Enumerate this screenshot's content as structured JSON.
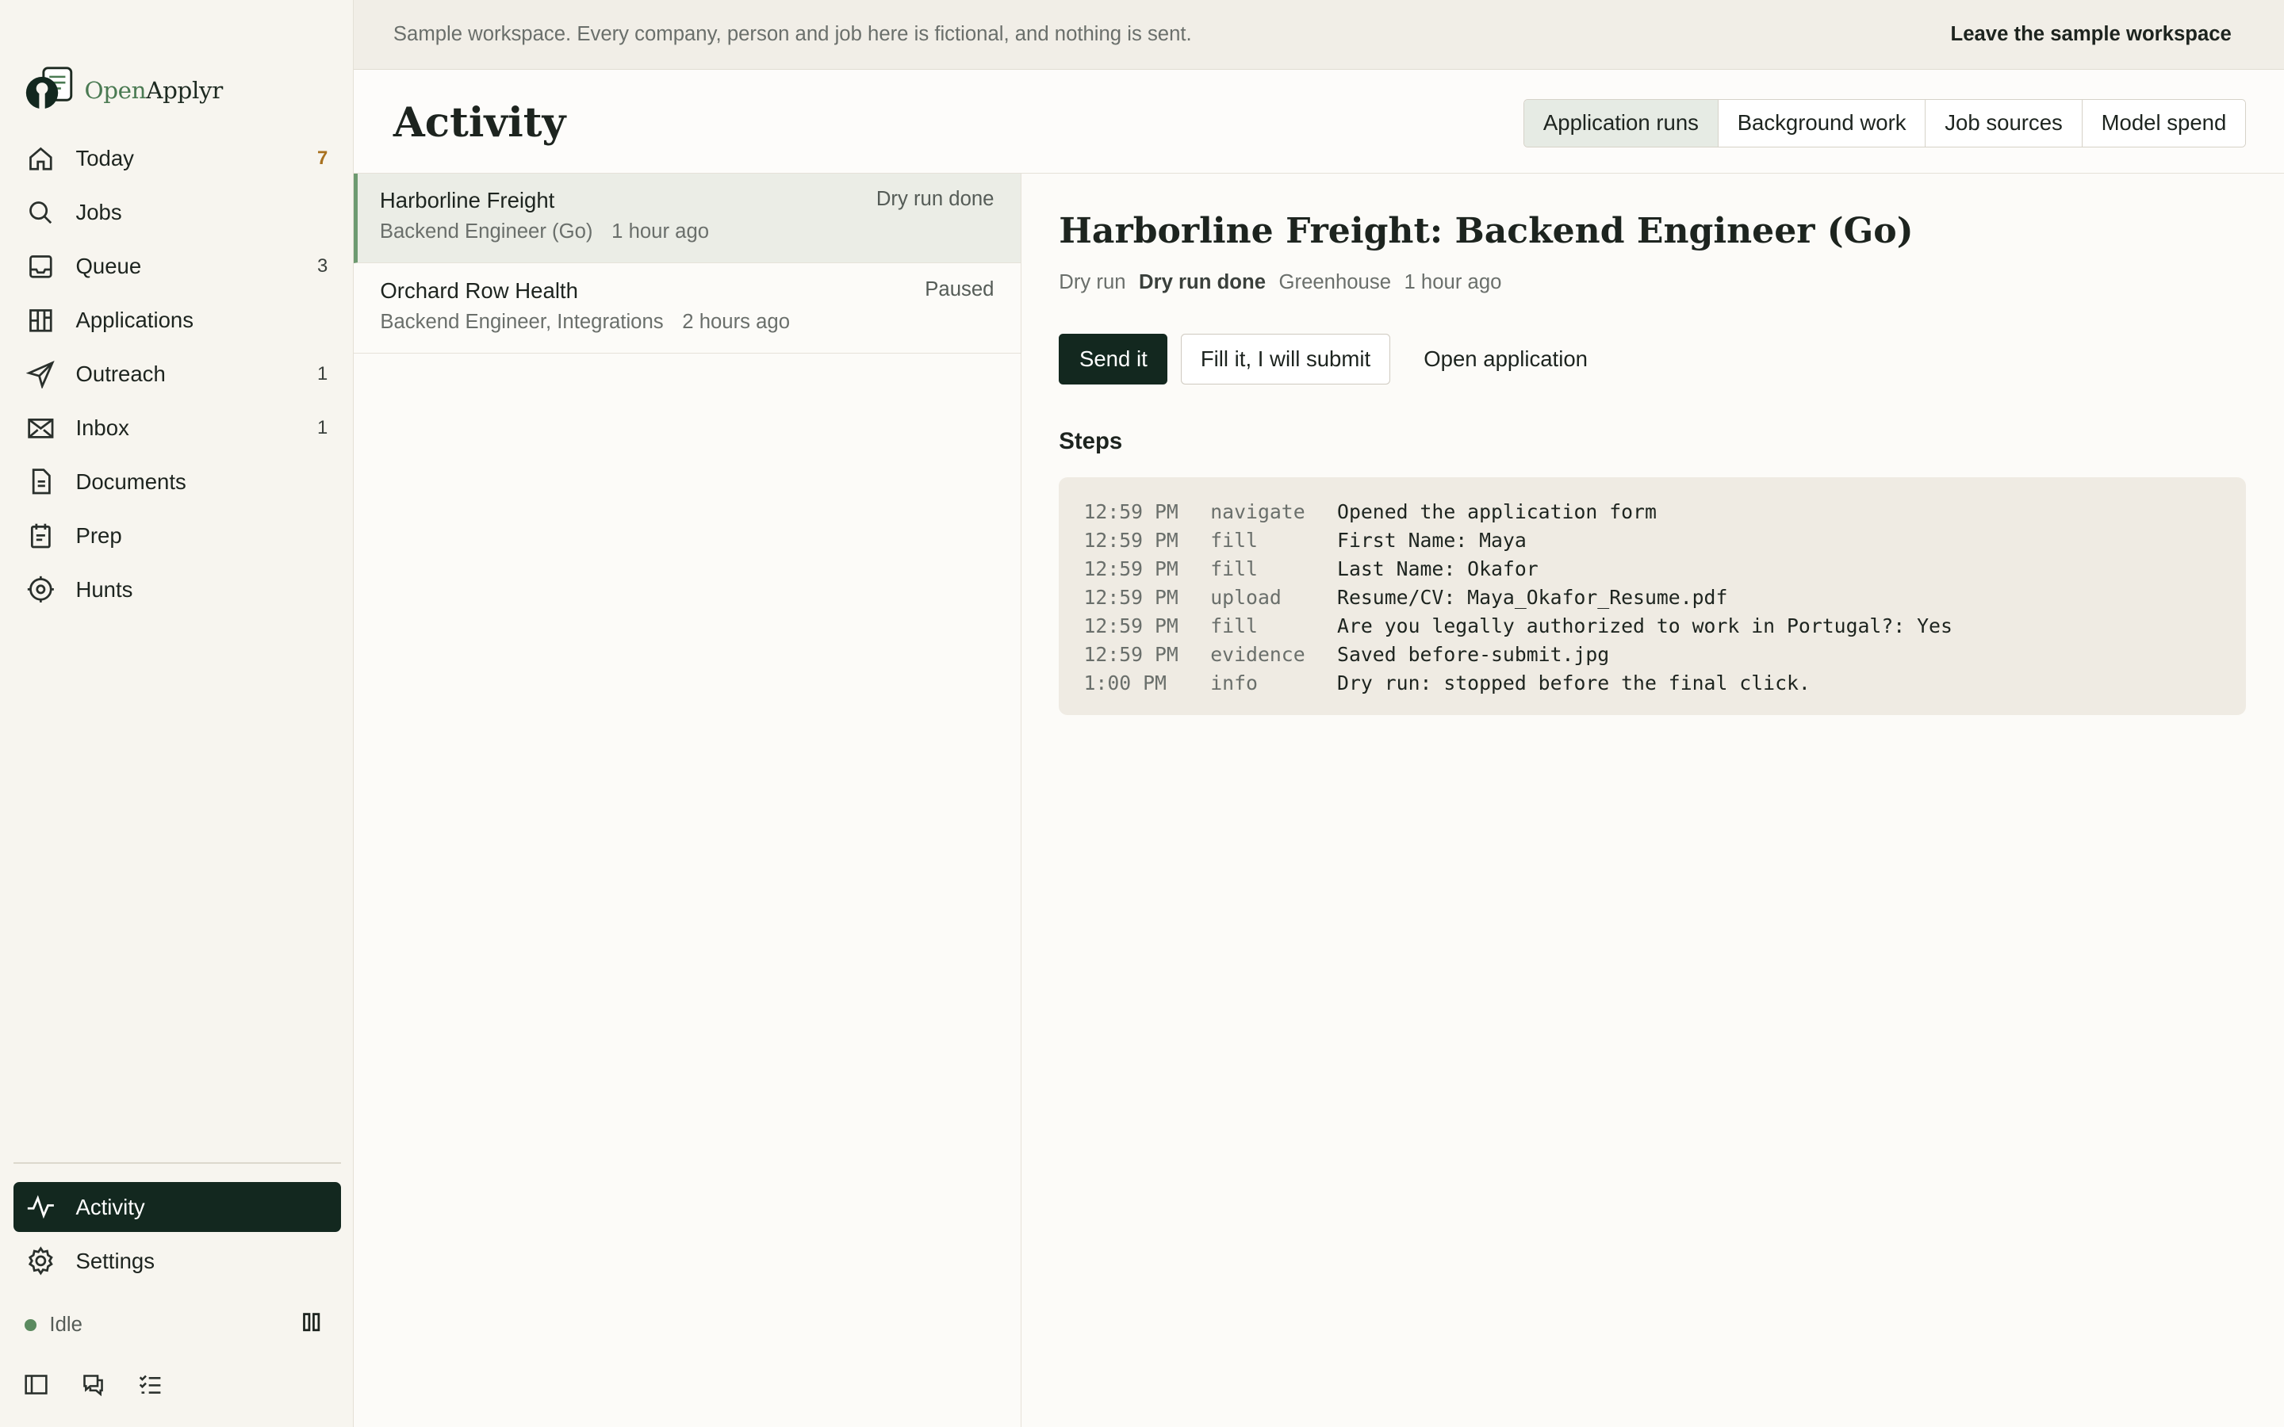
{
  "app": {
    "name_part1": "Open",
    "name_part2": "Applyr"
  },
  "banner": {
    "message": "Sample workspace. Every company, person and job here is fictional, and nothing is sent.",
    "leave_label": "Leave the sample workspace"
  },
  "nav": {
    "items": [
      {
        "label": "Today",
        "count": "7",
        "icon": "home-icon"
      },
      {
        "label": "Jobs",
        "count": "",
        "icon": "search-icon"
      },
      {
        "label": "Queue",
        "count": "3",
        "icon": "inbox-tray-icon"
      },
      {
        "label": "Applications",
        "count": "",
        "icon": "kanban-icon"
      },
      {
        "label": "Outreach",
        "count": "1",
        "icon": "send-icon"
      },
      {
        "label": "Inbox",
        "count": "1",
        "icon": "mail-icon"
      },
      {
        "label": "Documents",
        "count": "",
        "icon": "document-icon"
      },
      {
        "label": "Prep",
        "count": "",
        "icon": "calendar-icon"
      },
      {
        "label": "Hunts",
        "count": "",
        "icon": "target-icon"
      }
    ],
    "bottom": [
      {
        "label": "Activity",
        "icon": "activity-icon"
      },
      {
        "label": "Settings",
        "icon": "gear-icon"
      }
    ]
  },
  "status": {
    "label": "Idle"
  },
  "page": {
    "title": "Activity",
    "tabs": [
      "Application runs",
      "Background work",
      "Job sources",
      "Model spend"
    ],
    "active_tab": "Application runs"
  },
  "runs": [
    {
      "company": "Harborline Freight",
      "status": "Dry run done",
      "role": "Backend Engineer (Go)",
      "time": "1 hour ago"
    },
    {
      "company": "Orchard Row Health",
      "status": "Paused",
      "role": "Backend Engineer, Integrations",
      "time": "2 hours ago"
    }
  ],
  "detail": {
    "title": "Harborline Freight: Backend Engineer (Go)",
    "meta": {
      "mode": "Dry run",
      "status": "Dry run done",
      "source": "Greenhouse",
      "time": "1 hour ago"
    },
    "actions": {
      "send": "Send it",
      "fill": "Fill it, I will submit",
      "open": "Open application"
    },
    "steps_heading": "Steps",
    "steps": [
      {
        "time": "12:59 PM",
        "kind": "navigate",
        "message": "Opened the application form"
      },
      {
        "time": "12:59 PM",
        "kind": "fill",
        "message": "First Name: Maya"
      },
      {
        "time": "12:59 PM",
        "kind": "fill",
        "message": "Last Name: Okafor"
      },
      {
        "time": "12:59 PM",
        "kind": "upload",
        "message": "Resume/CV: Maya_Okafor_Resume.pdf"
      },
      {
        "time": "12:59 PM",
        "kind": "fill",
        "message": "Are you legally authorized to work in Portugal?: Yes"
      },
      {
        "time": "12:59 PM",
        "kind": "evidence",
        "message": "Saved before-submit.jpg"
      },
      {
        "time": "1:00 PM",
        "kind": "info",
        "message": "Dry run: stopped before the final click."
      }
    ]
  },
  "colors": {
    "brand_dark": "#13281f",
    "accent_count": "#a8711f",
    "status_idle": "#5b8a5f",
    "selected_border": "#6d9a70"
  }
}
